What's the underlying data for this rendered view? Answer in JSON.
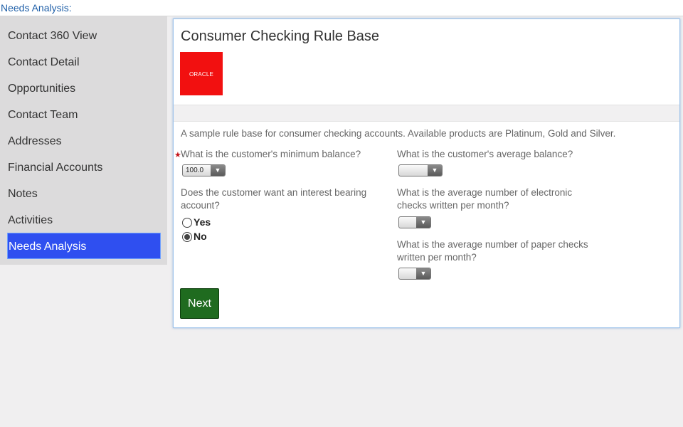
{
  "header": {
    "title": "Needs Analysis:"
  },
  "sidebar": {
    "items": [
      {
        "label": "Contact 360 View"
      },
      {
        "label": "Contact Detail"
      },
      {
        "label": "Opportunities"
      },
      {
        "label": "Contact Team"
      },
      {
        "label": "Addresses"
      },
      {
        "label": "Financial Accounts"
      },
      {
        "label": "Notes"
      },
      {
        "label": "Activities"
      },
      {
        "label": "Needs Analysis",
        "active": true
      }
    ]
  },
  "panel": {
    "title": "Consumer Checking Rule Base",
    "logo_text": "ORACLE",
    "brand_color": "#f21010",
    "description": "A sample rule base for consumer checking accounts.  Available products are Platinum, Gold and Silver.",
    "required_marker": "★",
    "questions": {
      "min_balance": {
        "text": "What is the customer's minimum balance?",
        "value": "100.0"
      },
      "avg_balance": {
        "text": "What is the customer's average balance?",
        "value": ""
      },
      "interest": {
        "text_line1": "Does the customer want an interest bearing",
        "text_line2": "account?",
        "options": [
          {
            "label": "Yes",
            "checked": false
          },
          {
            "label": "No",
            "checked": true
          }
        ]
      },
      "electronic_checks": {
        "text_line1": "What is the average number of electronic",
        "text_line2": "checks written per month?",
        "value": ""
      },
      "paper_checks": {
        "text_line1": "What is the average number of paper checks",
        "text_line2": "written per month?",
        "value": ""
      }
    },
    "next_label": "Next"
  }
}
